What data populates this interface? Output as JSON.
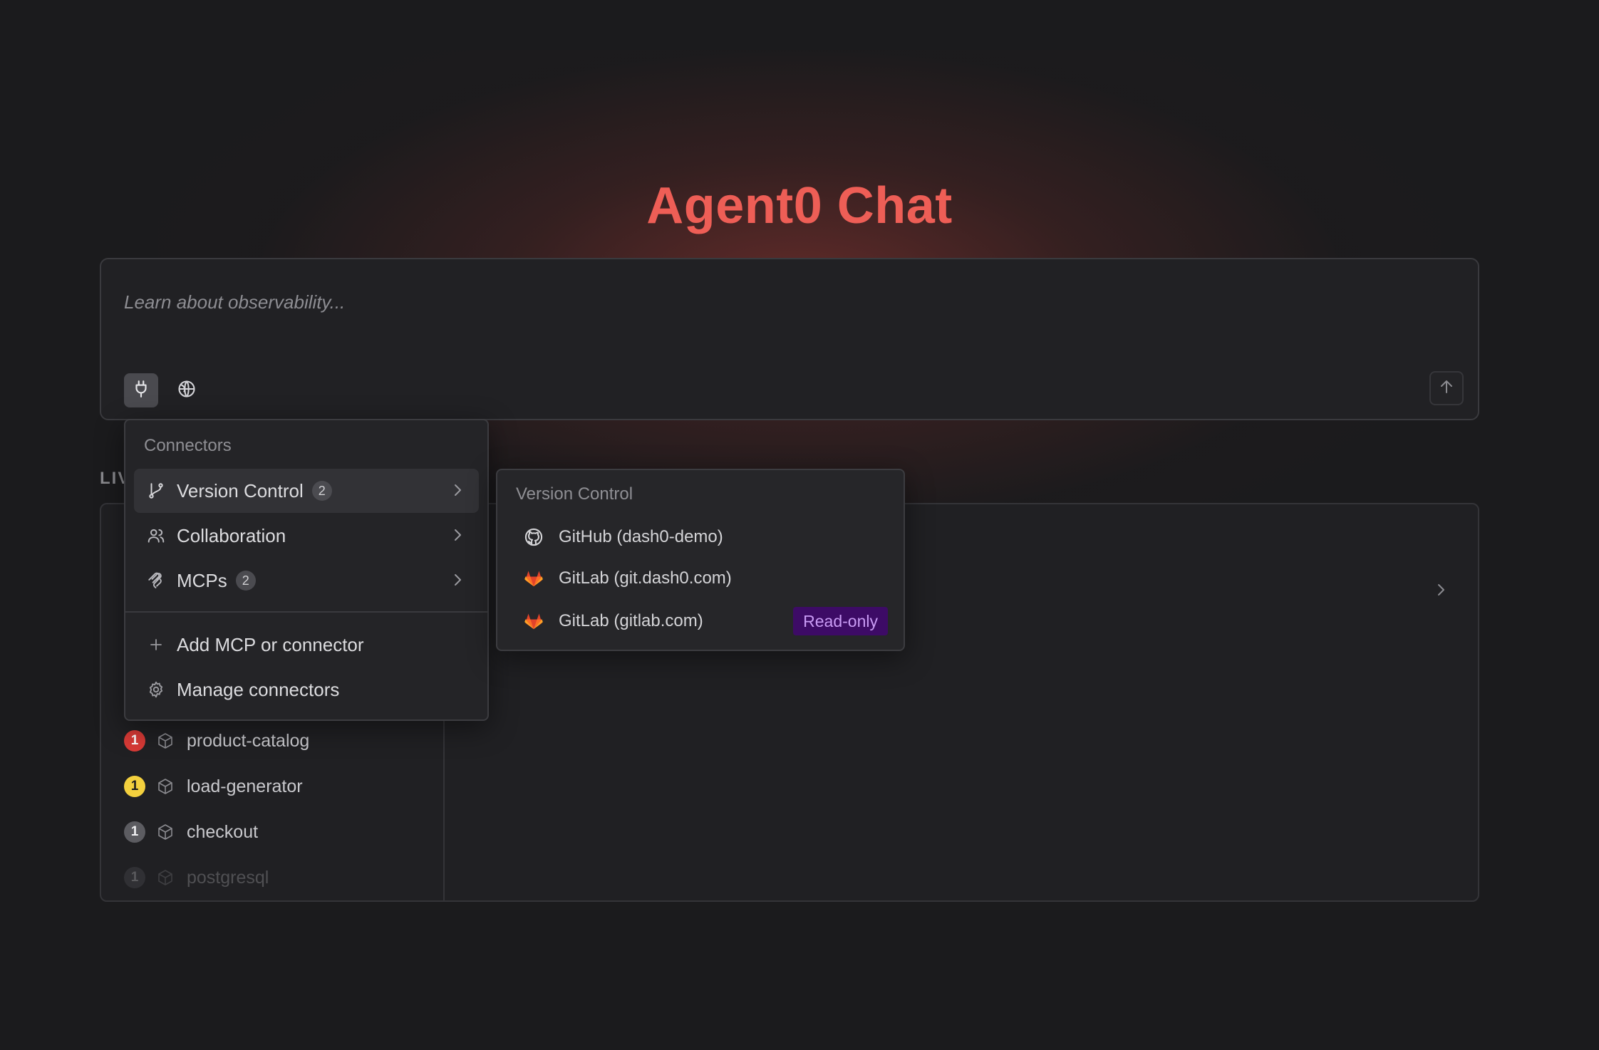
{
  "page": {
    "title": "Agent0 Chat"
  },
  "composer": {
    "placeholder": "Learn about observability...",
    "tools": [
      {
        "name": "connectors",
        "icon": "plug-icon"
      },
      {
        "name": "web",
        "icon": "globe-icon"
      }
    ],
    "send_icon": "arrow-up-icon"
  },
  "live_section": {
    "label": "LIV"
  },
  "services": [
    {
      "name": "product-catalog",
      "count": "1",
      "status_color": "#d83a36",
      "icon": "cube-icon"
    },
    {
      "name": "load-generator",
      "count": "1",
      "status_color": "#f3d03e",
      "icon": "cube-icon"
    },
    {
      "name": "checkout",
      "count": "1",
      "status_color": "#5c5c61",
      "icon": "cube-icon"
    },
    {
      "name": "postgresql",
      "count": "1",
      "status_color": "#5c5c61",
      "icon": "cube-icon"
    }
  ],
  "connectors_menu": {
    "header": "Connectors",
    "items": [
      {
        "label": "Version Control",
        "count": "2",
        "icon": "git-branch-icon",
        "active": true
      },
      {
        "label": "Collaboration",
        "icon": "users-icon"
      },
      {
        "label": "MCPs",
        "count": "2",
        "icon": "mcp-icon"
      }
    ],
    "actions": [
      {
        "label": "Add MCP or connector",
        "icon": "plus-icon"
      },
      {
        "label": "Manage connectors",
        "icon": "gear-icon"
      }
    ]
  },
  "version_control_submenu": {
    "header": "Version Control",
    "items": [
      {
        "label": "GitHub (dash0-demo)",
        "icon": "github-icon"
      },
      {
        "label": "GitLab (git.dash0.com)",
        "icon": "gitlab-icon"
      },
      {
        "label": "GitLab (gitlab.com)",
        "icon": "gitlab-icon",
        "badge": "Read-only"
      }
    ]
  },
  "colors": {
    "accent": "#ee5e56",
    "background": "#1b1b1d",
    "gitlab_orange": "#e2432a",
    "readonly_bg": "#3d0b66",
    "readonly_text": "#c99bf5"
  }
}
